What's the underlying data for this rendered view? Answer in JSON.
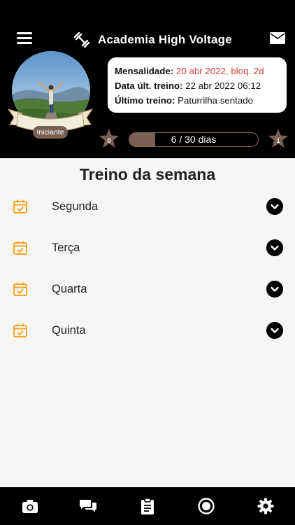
{
  "header": {
    "app_title": "Academia High Voltage",
    "icons": {
      "menu": "menu-icon",
      "logo": "dumbbell-icon",
      "mail": "mail-icon"
    }
  },
  "profile": {
    "rank_label": "Iniciante",
    "avatar": "profile-photo"
  },
  "info_card": {
    "mensalidade_label": "Mensalidade:",
    "mensalidade_value": "20 abr 2022, bloq. 2d",
    "data_label": "Data últ. treino:",
    "data_value": "22 abr 2022 06:12",
    "ultimo_label": "Último treino:",
    "ultimo_value": "Paturrilha sentado"
  },
  "progress": {
    "level_current": "0",
    "level_next": "1",
    "text": "6 / 30 dias",
    "fraction": 0.2
  },
  "week": {
    "title": "Treino da semana",
    "days": [
      {
        "label": "Segunda"
      },
      {
        "label": "Terça"
      },
      {
        "label": "Quarta"
      },
      {
        "label": "Quinta"
      }
    ]
  },
  "bottom_nav": {
    "items": [
      "camera-icon",
      "chat-icon",
      "clipboard-icon",
      "record-icon",
      "settings-icon"
    ]
  },
  "colors": {
    "header_bg": "#000000",
    "accent_brown": "#7a5f55",
    "warning_red": "#e0413a",
    "calendar_orange": "#f5a623"
  }
}
